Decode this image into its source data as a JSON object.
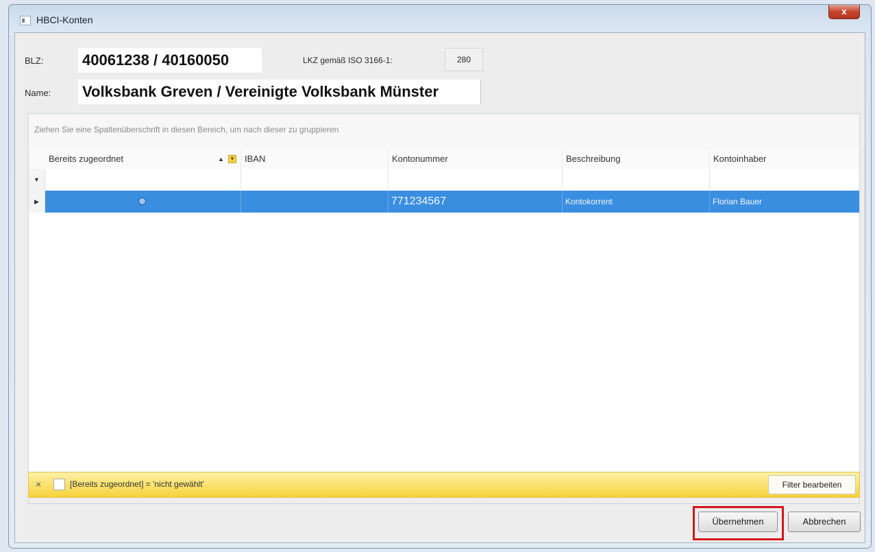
{
  "window": {
    "title": "HBCI-Konten",
    "close_label": "x"
  },
  "form": {
    "blz_label": "BLZ:",
    "blz_value": "40061238 / 40160050",
    "lkz_label": "LKZ gemäß ISO 3166-1:",
    "lkz_value": "280",
    "name_label": "Name:",
    "name_value": "Volksbank Greven / Vereinigte Volksbank Münster"
  },
  "grid": {
    "group_panel_text": "Ziehen Sie eine Spaltenüberschrift in diesen Bereich, um nach dieser zu gruppieren",
    "columns": [
      "Bereits zugeordnet",
      "IBAN",
      "Kontonummer",
      "Beschreibung",
      "Kontoinhaber"
    ],
    "rows": [
      {
        "bereits_zugeordnet": "",
        "iban": "",
        "kontonummer": "771234567",
        "beschreibung": "Kontokorrent",
        "kontoinhaber": "Florian Bauer"
      }
    ]
  },
  "filter_bar": {
    "close_label": "×",
    "expression": "[Bereits zugeordnet] = 'nicht gewählt'",
    "edit_button": "Filter bearbeiten"
  },
  "buttons": {
    "accept": "Übernehmen",
    "cancel": "Abbrechen"
  },
  "colors": {
    "selection": "#3a8ee0",
    "filter_bar": "#f6d23a",
    "highlight": "#d2141b"
  }
}
